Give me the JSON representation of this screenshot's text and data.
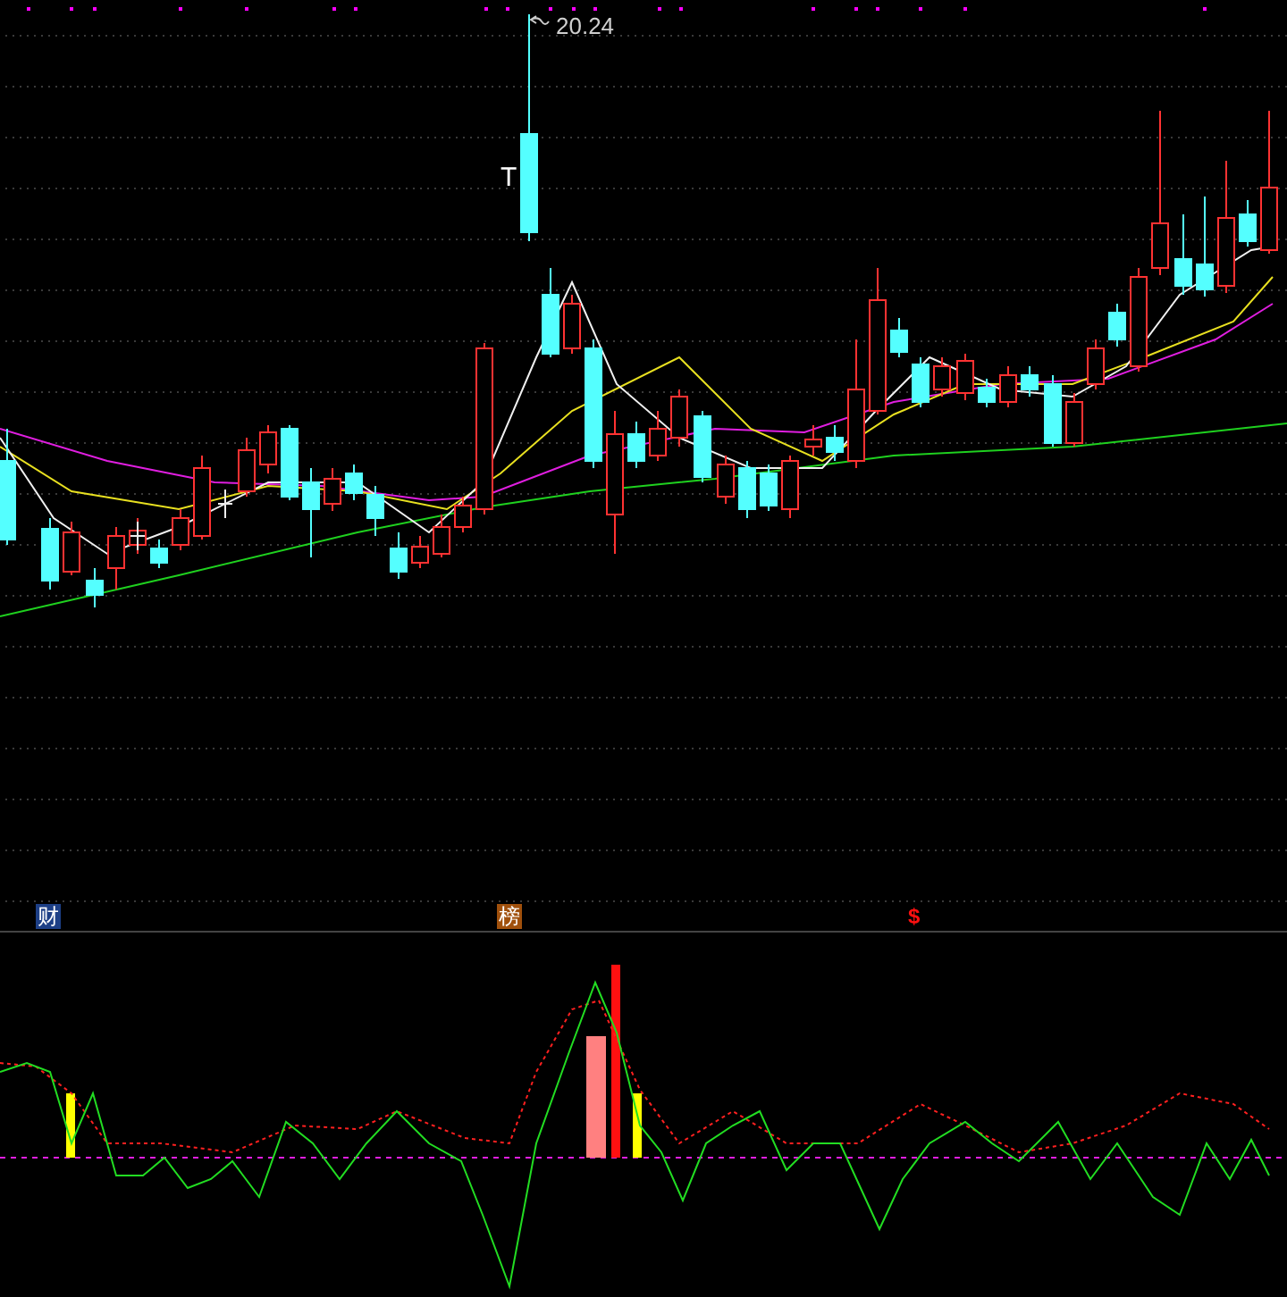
{
  "price_chart": {
    "high_label": "20.24",
    "signal_mark": "T"
  },
  "markers": [
    {
      "kind": "badge",
      "text": "财",
      "color": "#1d3f86"
    },
    {
      "kind": "badge",
      "text": "榜",
      "color": "#a0500c"
    },
    {
      "kind": "plain",
      "text": "$",
      "color": "#ff1010"
    }
  ]
}
